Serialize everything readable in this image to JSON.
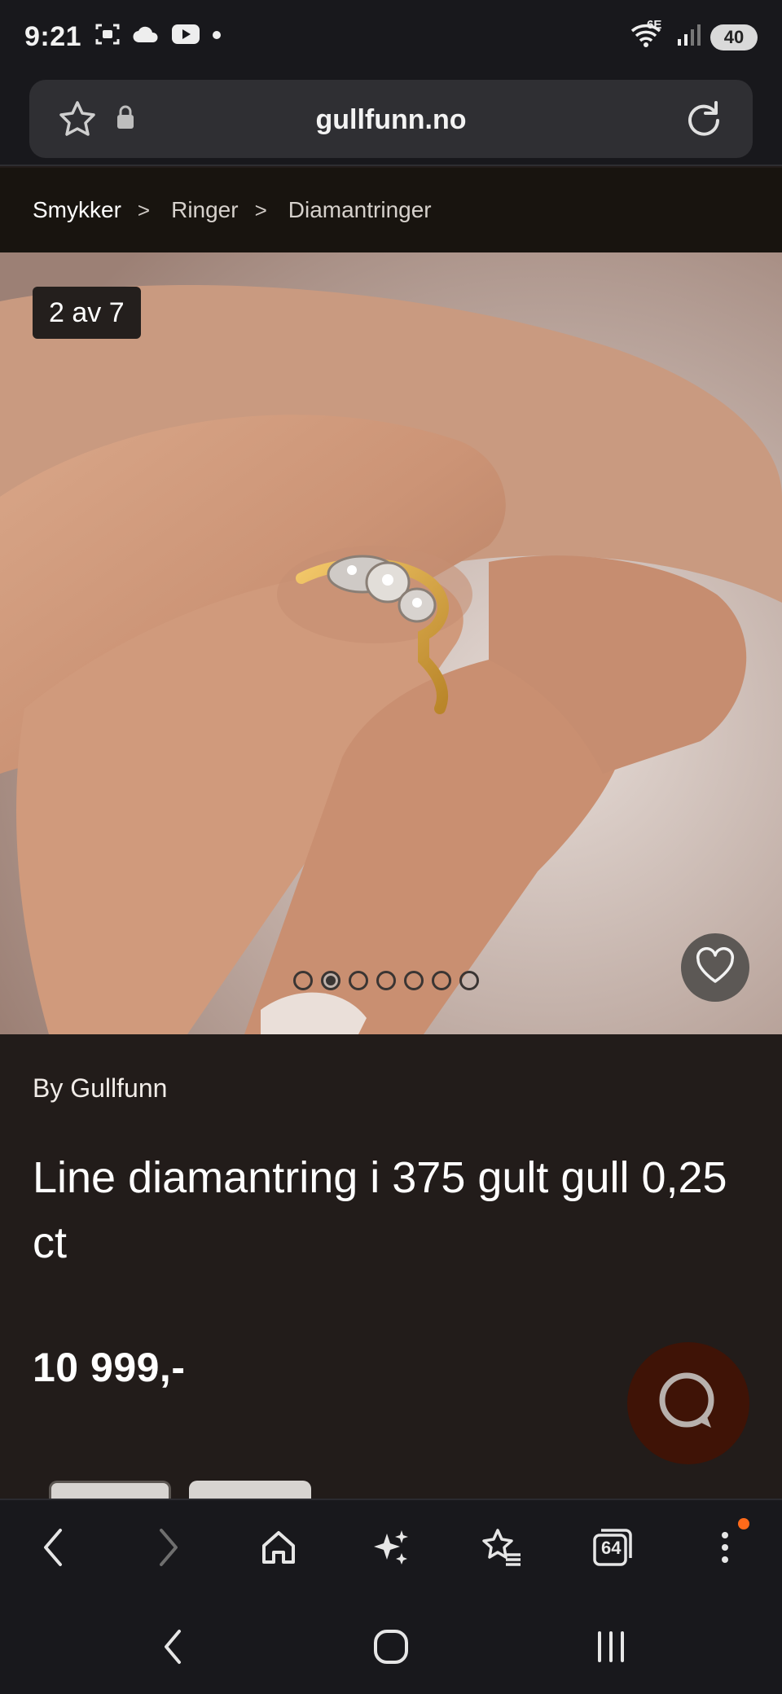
{
  "status_bar": {
    "time": "9:21",
    "network_label": "6E",
    "battery": "40"
  },
  "browser": {
    "url": "gullfunn.no",
    "tabs_count": "64"
  },
  "breadcrumb": {
    "items": [
      "Smykker",
      "Ringer",
      "Diamantringer"
    ],
    "separator": ">"
  },
  "gallery": {
    "counter": "2 av 7",
    "current_index": 2,
    "total_images": 7
  },
  "product": {
    "brand": "By Gullfunn",
    "title": "Line diamantring i 375 gult gull 0,25 ct",
    "price": "10 999,-"
  },
  "colors": {
    "page_background": "#221c1a",
    "chrome_background": "#18181c",
    "chat_accent": "#3f1306",
    "notification_dot": "#ff6a1a"
  },
  "icons": {
    "favorite": "star-outline-icon",
    "lock": "lock-icon",
    "reload": "reload-icon",
    "wishlist": "heart-icon",
    "chat": "chat-bubble-icon",
    "back": "chevron-left-icon",
    "forward": "chevron-right-icon",
    "home": "home-icon",
    "ai": "sparkles-icon",
    "bookmarks": "star-list-icon",
    "tabs": "tabs-icon",
    "menu": "more-vertical-icon"
  }
}
